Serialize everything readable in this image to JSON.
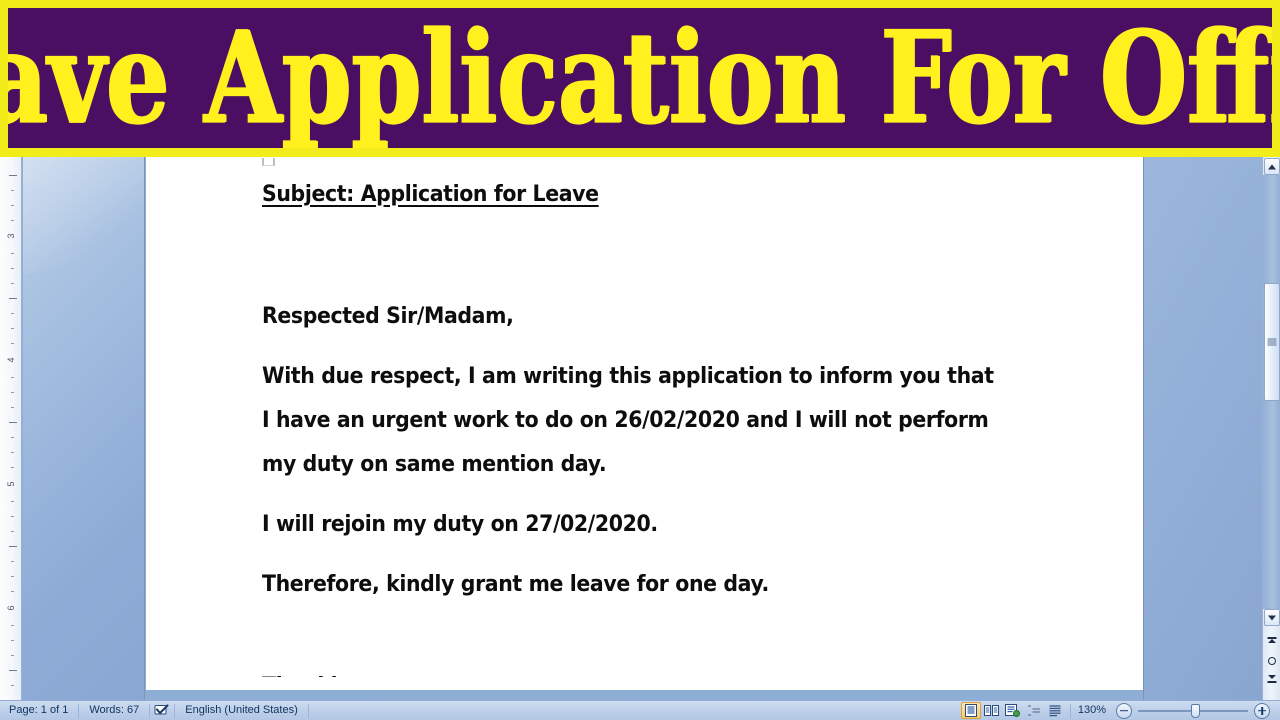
{
  "banner": {
    "title": "Leave Application For Office",
    "background_color": "#4A0F62",
    "border_color": "#F2EC1A",
    "text_color": "#FFF01E"
  },
  "document": {
    "subject": "Subject: Application for Leave",
    "salutation": "Respected Sir/Madam,",
    "paragraph_1": "With due respect, I am writing this application to inform you that I have an urgent work to do on 26/02/2020 and I will not perform my duty on same mention day.",
    "paragraph_2": "I will rejoin my duty on 27/02/2020.",
    "paragraph_3": "Therefore, kindly grant me leave for one day.",
    "paragraph_4": "Thanking you,"
  },
  "ruler": {
    "numbers": [
      "3",
      "4",
      "5",
      "6"
    ]
  },
  "scrollbar": {
    "up_arrow": "scroll-up-arrow",
    "down_arrow": "scroll-down-arrow",
    "previous_page": "previous-page",
    "select_browse_object": "select-browse-object",
    "next_page": "next-page"
  },
  "statusbar": {
    "page": "Page: 1 of 1",
    "words": "Words: 67",
    "spell_icon": "spell-check-icon",
    "language": "English (United States)",
    "views": [
      {
        "name": "print-layout-view",
        "active": true
      },
      {
        "name": "full-screen-reading-view",
        "active": false
      },
      {
        "name": "web-layout-view",
        "active": false
      },
      {
        "name": "outline-view",
        "active": false
      },
      {
        "name": "draft-view",
        "active": false
      }
    ],
    "zoom_level": "130%",
    "zoom_out_icon": "zoom-out-icon",
    "zoom_in_icon": "zoom-in-icon"
  }
}
